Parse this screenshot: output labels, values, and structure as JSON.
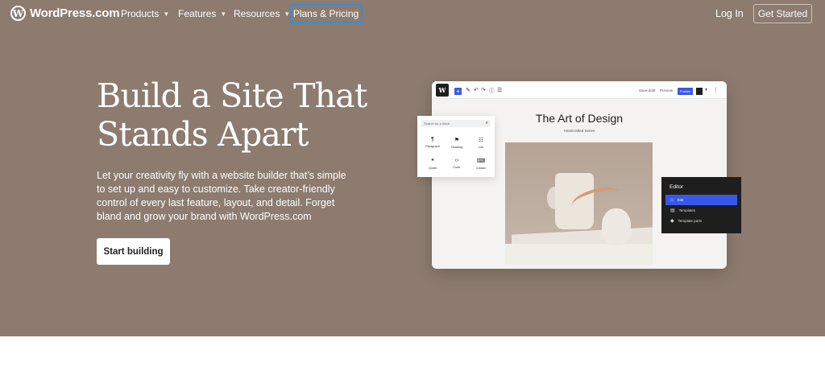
{
  "nav": {
    "logo_mark": "W",
    "logo_text": "WordPress.com",
    "products": "Products",
    "features": "Features",
    "resources": "Resources",
    "plans": "Plans & Pricing",
    "caret": "▼",
    "login": "Log In",
    "get_started": "Get Started"
  },
  "hero": {
    "headline_line1": "Build a Site That",
    "headline_line2": "Stands Apart",
    "subtext": "Let your creativity fly with a website builder that’s simple to set up and easy to customize. Take creator-friendly control of every last feature, layout, and detail. Forget bland and grow your brand with WordPress.com",
    "cta": "Start building",
    "background_color": "#8c7b6e"
  },
  "mock_editor": {
    "wp_mark": "W",
    "toolbar_save_draft": "Save draft",
    "toolbar_preview": "Preview",
    "toolbar_publish": "Publish",
    "page_title": "The Art of Design",
    "page_subtitle": "Handcrafted Series",
    "accent_color": "#3858e9"
  },
  "inserter": {
    "search_placeholder": "Search for a block",
    "blocks": [
      {
        "label": "Paragraph",
        "icon": "¶"
      },
      {
        "label": "Heading",
        "icon": "⚑"
      },
      {
        "label": "List",
        "icon": "☷"
      },
      {
        "label": "Quote",
        "icon": "❝"
      },
      {
        "label": "Code",
        "icon": "‹›"
      },
      {
        "label": "Classic",
        "icon": "⌨"
      }
    ]
  },
  "editor_panel": {
    "title": "Editor",
    "items": [
      {
        "label": "Site",
        "icon": "⌂"
      },
      {
        "label": "Templates",
        "icon": "▤"
      },
      {
        "label": "Template parts",
        "icon": "◆"
      }
    ]
  }
}
